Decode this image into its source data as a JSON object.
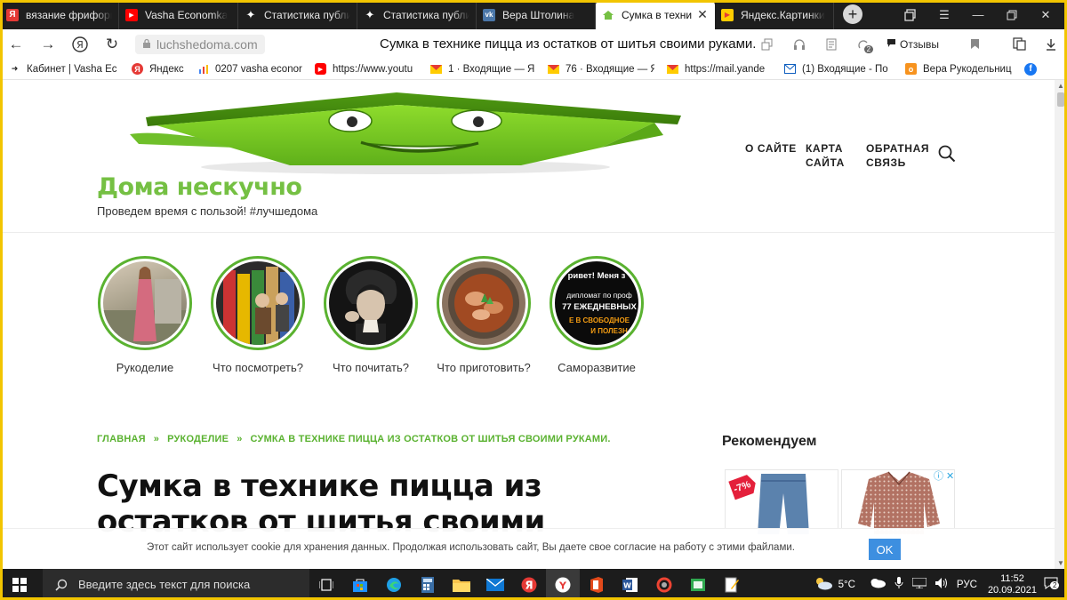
{
  "browser": {
    "tabs": [
      {
        "label": "вязание фриформ",
        "icon": "yandex-icon",
        "color": "#e53935",
        "glyph": "Я"
      },
      {
        "label": "Vasha Economka",
        "icon": "youtube-icon",
        "color": "#ff0000",
        "glyph": "▶"
      },
      {
        "label": "Статистика публи",
        "icon": "dzen-icon",
        "color": "#ffffff",
        "glyph": "✦"
      },
      {
        "label": "Статистика публи",
        "icon": "dzen-icon",
        "color": "#ffffff",
        "glyph": "✦"
      },
      {
        "label": "Вера Штолина",
        "icon": "vk-icon",
        "color": "#4a76a8",
        "glyph": "vk"
      },
      {
        "label": "Сумка в техни",
        "icon": "site-favicon",
        "color": "#75c043",
        "glyph": "⌂",
        "active": true
      },
      {
        "label": "Яндекс.Картинки",
        "icon": "yandex-images-icon",
        "color": "#ffcc00",
        "glyph": "▶"
      }
    ],
    "url": "luchshedoma.com",
    "page_title": "Сумка в технике пицца из остатков от шитья своими руками.",
    "reviews_label": "Отзывы",
    "downloads_count": "2",
    "bookmarks": [
      {
        "label": "Кабинет | Vasha Ec",
        "icon": "bookmark-page-icon"
      },
      {
        "label": "Яндекс",
        "icon": "yandex-icon"
      },
      {
        "label": "0207 vasha econor",
        "icon": "chart-icon"
      },
      {
        "label": "https://www.youtu",
        "icon": "youtube-icon"
      },
      {
        "label": "1 · Входящие — Я",
        "icon": "mail-icon"
      },
      {
        "label": "76 · Входящие — Я",
        "icon": "mail-icon"
      },
      {
        "label": "https://mail.yande",
        "icon": "mail-icon"
      },
      {
        "label": "(1) Входящие - По",
        "icon": "outlook-icon"
      },
      {
        "label": "Вера Рукодельниц",
        "icon": "ok-icon"
      }
    ]
  },
  "site": {
    "title": "Дома нескучно",
    "tagline": "Проведем время с пользой! #лучшедома",
    "nav": {
      "about": "О САЙТЕ",
      "sitemap": "КАРТА САЙТА",
      "feedback": "ОБРАТНАЯ СВЯЗЬ"
    },
    "categories": [
      {
        "label": "Рукоделие"
      },
      {
        "label": "Что посмотреть?"
      },
      {
        "label": "Что почитать?"
      },
      {
        "label": "Что приготовить?"
      },
      {
        "label": "Саморазвитие",
        "image_lines": [
          "ривет! Меня з",
          "дипломат по проф",
          "77 ЕЖЕДНЕВНЫХ",
          "Е В СВОБОДНОЕ",
          "И ПОЛЕЗН"
        ]
      }
    ],
    "breadcrumbs": [
      "ГЛАВНАЯ",
      "РУКОДЕЛИЕ",
      "СУМКА В ТЕХНИКЕ ПИЦЦА ИЗ ОСТАТКОВ ОТ ШИТЬЯ СВОИМИ РУКАМИ."
    ],
    "breadcrumb_sep": "»",
    "post_title": "Сумка в технике пицца из остатков от шитья своими",
    "recommend_title": "Рекомендуем",
    "ad_discount": "-7%",
    "cookie_text": "Этот сайт использует cookie для хранения данных. Продолжая использовать сайт, Вы даете свое согласие на работу с этими файлами.",
    "cookie_ok": "OK"
  },
  "taskbar": {
    "search_placeholder": "Введите здесь текст для поиска",
    "weather": "5°C",
    "lang": "РУС",
    "time": "11:52",
    "date": "20.09.2021",
    "notifications": "2"
  },
  "colors": {
    "brand_green": "#75c043",
    "circle_green": "#5ab230",
    "frame_yellow": "#f2c500",
    "cookie_button": "#3d8fe0"
  }
}
